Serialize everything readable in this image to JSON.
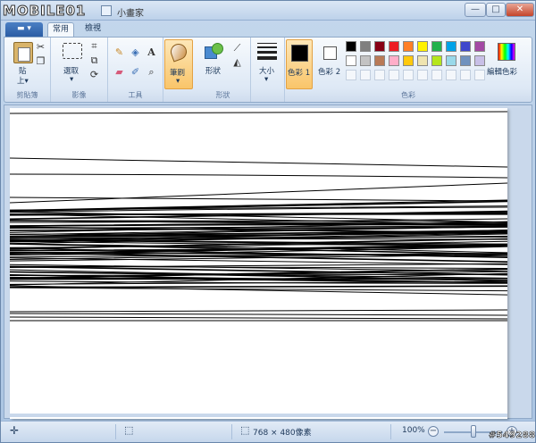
{
  "window": {
    "logo": "MOBILE01",
    "title": "小畫家",
    "min_glyph": "—",
    "max_glyph": "□",
    "close_glyph": "✕"
  },
  "tabs": {
    "menu": "▬ ▾",
    "home": "常用",
    "view": "檢視"
  },
  "ribbon": {
    "clipboard": {
      "group_label": "剪貼簿",
      "paste_label": "貼",
      "paste_sub": "上▾"
    },
    "image": {
      "group_label": "影像",
      "select_label": "選取",
      "select_arrow": "▾"
    },
    "tools": {
      "group_label": "工具"
    },
    "brushes": {
      "label": "筆刷",
      "arrow": "▾"
    },
    "shapes": {
      "group_label": "形狀",
      "shapes_label": "形狀"
    },
    "size": {
      "label": "大小",
      "arrow": "▾"
    },
    "colors": {
      "group_label": "色彩",
      "color1_label": "色彩 1",
      "color2_label": "色彩 2",
      "edit_colors_label": "編輯色彩",
      "color1": "#000000",
      "color2": "#ffffff",
      "palette_row1": [
        "#000000",
        "#7f7f7f",
        "#880015",
        "#ed1c24",
        "#ff7f27",
        "#fff200",
        "#22b14c",
        "#00a2e8",
        "#3f48cc",
        "#a349a4"
      ],
      "palette_row2": [
        "#ffffff",
        "#c3c3c3",
        "#b97a57",
        "#ffaec9",
        "#ffc90e",
        "#efe4b0",
        "#b5e61d",
        "#99d9ea",
        "#7092be",
        "#c8bfe7"
      ]
    }
  },
  "status": {
    "canvas_size": "768 × 480像素",
    "zoom": "100%",
    "zoom_minus": "−",
    "zoom_plus": "+",
    "zoom_level": 0.5
  },
  "watermark": "#549288"
}
